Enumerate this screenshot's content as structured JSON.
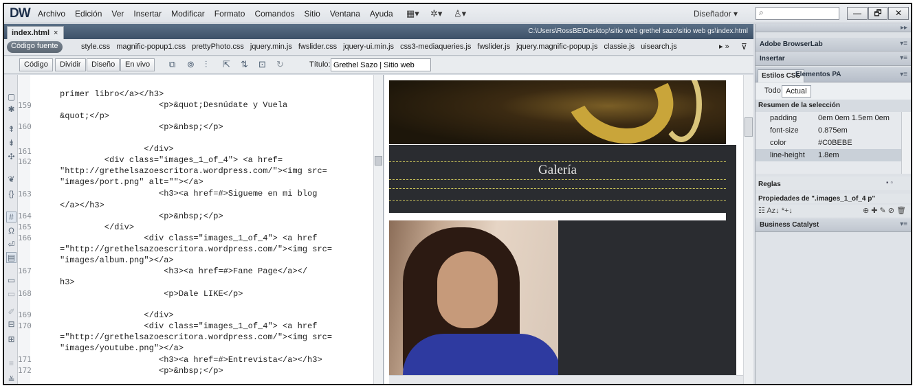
{
  "app": {
    "logo": "DW",
    "menus": [
      "Archivo",
      "Edición",
      "Ver",
      "Insertar",
      "Modificar",
      "Formato",
      "Comandos",
      "Sitio",
      "Ventana",
      "Ayuda"
    ],
    "workspace": "Diseñador",
    "search_placeholder": "",
    "window_buttons": {
      "minimize": "—",
      "restore": "🗗",
      "close": "✕"
    }
  },
  "document": {
    "tab_label": "index.html",
    "tab_close": "×",
    "path": "C:\\Users\\RossBE\\Desktop\\sitio web grethel sazo\\sitio web gs\\index.html",
    "source_button": "Código fuente",
    "related_files": [
      "style.css",
      "magnific-popup1.css",
      "prettyPhoto.css",
      "jquery.min.js",
      "fwslider.css",
      "jquery-ui.min.js",
      "css3-mediaqueries.js",
      "fwslider.js",
      "jquery.magnific-popup.js",
      "classie.js",
      "uisearch.js"
    ],
    "view_buttons": [
      "Código",
      "Dividir",
      "Diseño",
      "En vivo"
    ],
    "title_label": "Título:",
    "title_value": "Grethel Sazo | Sitio web"
  },
  "code": {
    "line_numbers": [
      "159",
      "160",
      "161",
      "162",
      "163",
      "164",
      "165",
      "166",
      "167",
      "168",
      "169",
      "170",
      "171",
      "172"
    ],
    "lines": [
      "primer libro</a></h3>",
      "                    <p>&quot;Desnúdate y Vuela",
      "&quot;</p>",
      "                    <p>&nbsp;</p>",
      "",
      "                 </div>",
      "         <div class=\"images_1_of_4\"> <a href=",
      "\"http://grethelsazoescritora.wordpress.com/\"><img src=",
      "\"images/port.png\" alt=\"\"></a>",
      "                    <h3><a href=#>Sigueme en mi blog",
      "</a></h3>",
      "                    <p>&nbsp;</p>",
      "         </div>",
      "                 <div class=\"images_1_of_4\"> <a href",
      "=\"http://grethelsazoescritora.wordpress.com/\"><img src=",
      "\"images/album.png\"></a>",
      "                     <h3><a href=#>Fane Page</a></",
      "h3>",
      "                     <p>Dale LIKE</p>",
      "",
      "                 </div>",
      "                 <div class=\"images_1_of_4\"> <a href",
      "=\"http://grethelsazoescritora.wordpress.com/\"><img src=",
      "\"images/youtube.png\"></a>",
      "                    <h3><a href=#>Entrevista</a></h3>",
      "                    <p>&nbsp;</p>"
    ]
  },
  "design": {
    "gallery_title": "Galería"
  },
  "panel": {
    "browserlab": "Adobe BrowserLab",
    "insertar": "Insertar",
    "tab_css": "Estilos CSS",
    "tab_pa": "Elementos PA",
    "mode_all": "Todo",
    "mode_current": "Actual",
    "summary_header": "Resumen de la selección",
    "properties": [
      {
        "name": "padding",
        "value": "0em 0em 1.5em 0em"
      },
      {
        "name": "font-size",
        "value": "0.875em"
      },
      {
        "name": "color",
        "value": "#C0BEBE"
      },
      {
        "name": "line-height",
        "value": "1.8em"
      }
    ],
    "rules": "Reglas",
    "props_of": "Propiedades de \".images_1_of_4 p\"",
    "business_catalyst": "Business Catalyst"
  }
}
